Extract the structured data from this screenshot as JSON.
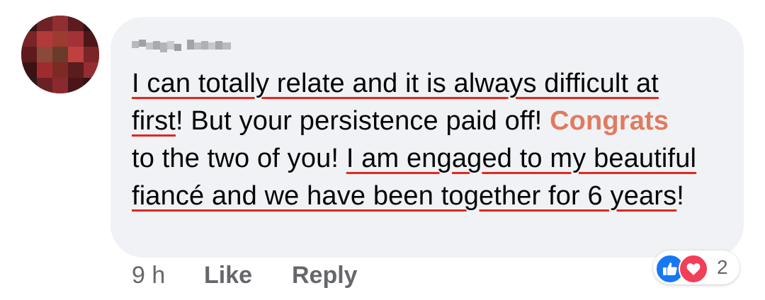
{
  "comment": {
    "author_name": "",
    "segments": {
      "s1": "I can totally relate and it is always difficult at",
      "s2": "first",
      "s3": "! But your persistence paid off! ",
      "s4": "Congrats",
      "s5": "to the two of you! ",
      "s6": "I am engaged to my beautiful fiancé and we have been together for 6 years",
      "s7": "!"
    },
    "underline_color": "#e0281f",
    "tag_color": "#e07b5f",
    "bubble_color": "#f0f2f5"
  },
  "actions": {
    "time": "9 h",
    "like_label": "Like",
    "reply_label": "Reply"
  },
  "reactions": {
    "icons": [
      "thumbs-up-icon",
      "heart-icon"
    ],
    "count": "2",
    "like_color": "#1877f2",
    "love_color": "#f33e58"
  },
  "avatar": {
    "style": "pixelated",
    "colors": [
      "#4a1418",
      "#8a2a2e",
      "#b23a3a",
      "#6b3b2a",
      "#2a1a1a"
    ]
  }
}
